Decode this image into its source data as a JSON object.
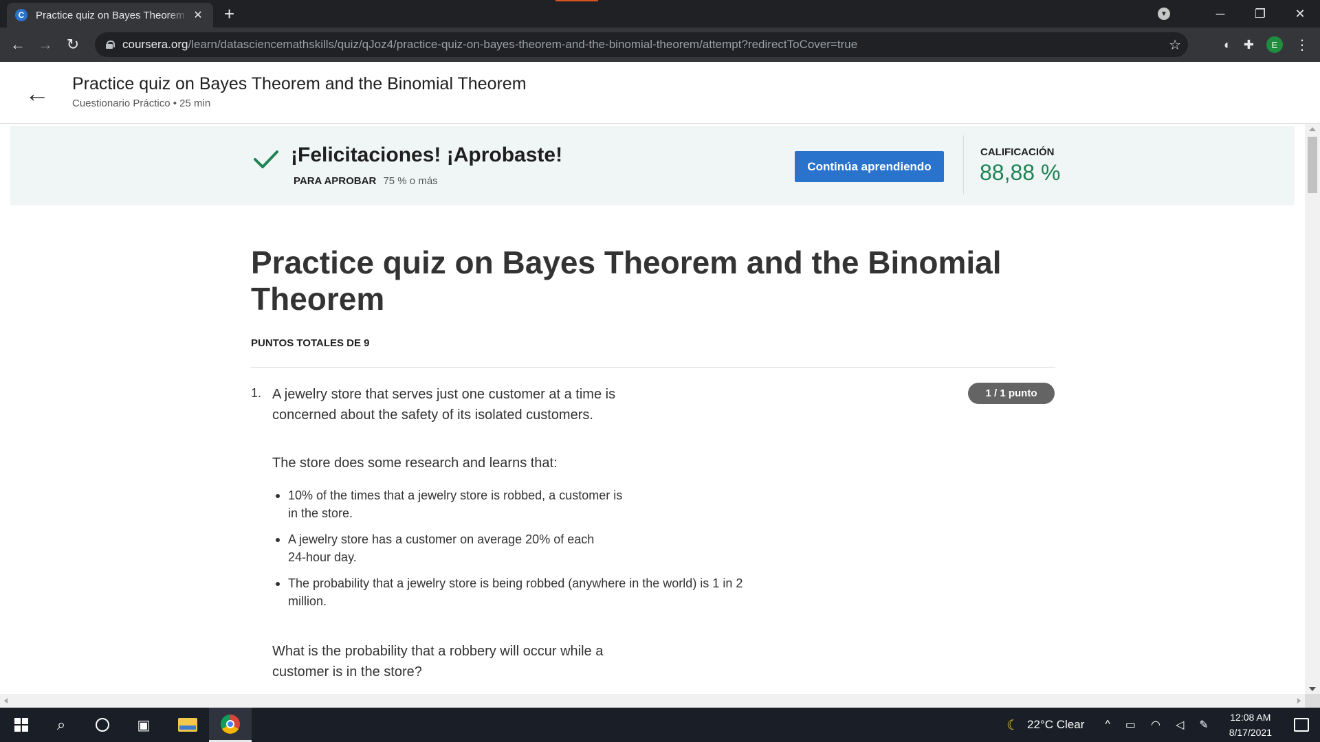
{
  "browser": {
    "tab_title": "Practice quiz on Bayes Theorem and the Binomial Theorem",
    "tab_favicon_letter": "C",
    "new_tab_label": "+",
    "url_host": "coursera.org",
    "url_path": "/learn/datasciencemathskills/quiz/qJoz4/practice-quiz-on-bayes-theorem-and-the-binomial-theorem/attempt?redirectToCover=true",
    "profile_initial": "E"
  },
  "header": {
    "title": "Practice quiz on Bayes Theorem and the Binomial Theorem",
    "subtitle": "Cuestionario Práctico • 25 min"
  },
  "banner": {
    "congrats": "¡Felicitaciones! ¡Aprobaste!",
    "pass_label": "PARA APROBAR",
    "pass_value": "75 % o más",
    "continue_label": "Continúa aprendiendo",
    "grade_label": "CALIFICACIÓN",
    "grade_value": "88,88 %"
  },
  "quiz": {
    "title": "Practice quiz on Bayes Theorem and the Binomial Theorem",
    "total_points": "PUNTOS TOTALES DE 9",
    "question_number": "1.",
    "question_intro": "A jewelry store that serves just one customer at a time is concerned about the safety of its isolated customers.",
    "points_badge": "1 / 1 punto",
    "research_text": "The store does some research and learns that:",
    "bullets": [
      "10% of the times that a jewelry store is robbed, a customer is in the store.",
      "A jewelry store has a customer on average 20% of each 24-hour day.",
      "The probability that a jewelry store is being robbed (anywhere in the world) is 1 in 2 million."
    ],
    "question_text": "What is the probability that a robbery will occur while a customer is in the store?"
  },
  "taskbar": {
    "weather": "22°C  Clear",
    "time": "12:08 AM",
    "date": "8/17/2021"
  },
  "colors": {
    "accent_blue": "#2a73cc",
    "success_green": "#1f8354",
    "banner_bg": "#f0f6f6"
  }
}
